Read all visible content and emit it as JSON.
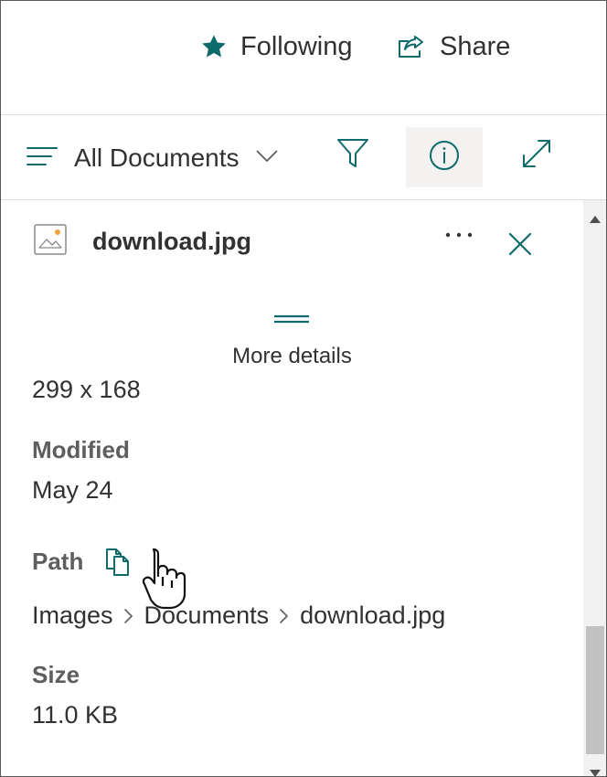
{
  "commandbar": {
    "following_label": "Following",
    "share_label": "Share"
  },
  "viewbar": {
    "view_label": "All Documents"
  },
  "details": {
    "file_name": "download.jpg",
    "more_details_label": "More details",
    "dimensions": "299 x 168",
    "modified_label": "Modified",
    "modified_value": "May 24",
    "path_label": "Path",
    "path_segments": [
      "Images",
      "Documents",
      "download.jpg"
    ],
    "size_label": "Size",
    "size_value": "11.0 KB"
  },
  "colors": {
    "accent": "#0f6b6b",
    "text": "#323130",
    "label": "#605e5c",
    "active_bg": "#f3f2f1"
  },
  "icons": {
    "following": "star-icon",
    "share": "share-icon",
    "view": "list-lines-icon",
    "filter": "filter-icon",
    "info": "info-icon",
    "expand": "expand-icon",
    "file": "image-file-icon",
    "more": "more-dots-icon",
    "close": "close-icon",
    "copy": "copy-icon",
    "cursor": "hand-cursor-icon"
  }
}
